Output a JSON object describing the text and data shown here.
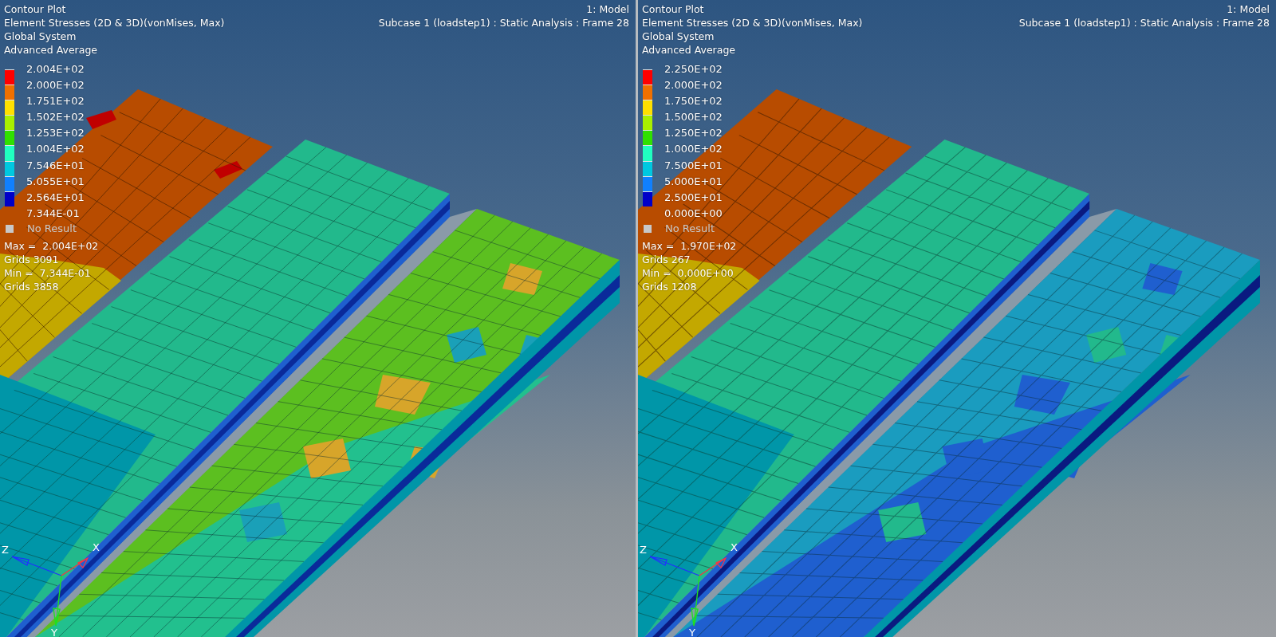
{
  "viewports": [
    {
      "header": {
        "title": "Contour Plot",
        "result": "Element Stresses (2D & 3D)(vonMises, Max)",
        "system": "Global System",
        "averaging": "Advanced Average",
        "model": "1: Model",
        "subcase": "Subcase 1 (loadstep1) : Static Analysis : Frame 28"
      },
      "legend": {
        "values": [
          "2.004E+02",
          "2.000E+02",
          "1.751E+02",
          "1.502E+02",
          "1.253E+02",
          "1.004E+02",
          "7.546E+01",
          "5.055E+01",
          "2.564E+01",
          "7.344E-01"
        ],
        "bands": [
          {
            "color": "#ff0000"
          },
          {
            "color": "#f07000"
          },
          {
            "color": "#ffe000"
          },
          {
            "color": "#a8f000"
          },
          {
            "color": "#30e000"
          },
          {
            "color": "#20ffc0"
          },
          {
            "color": "#00c8e0"
          },
          {
            "color": "#1080ff"
          },
          {
            "color": "#0000c8"
          }
        ],
        "no_result": "No Result"
      },
      "stats": [
        "Max =  2.004E+02",
        "Grids 3091",
        "Min =  7.344E-01",
        "Grids 3858"
      ],
      "axes": {
        "x": "X",
        "y": "Y",
        "z": "Z"
      }
    },
    {
      "header": {
        "title": "Contour Plot",
        "result": "Element Stresses (2D & 3D)(vonMises, Max)",
        "system": "Global System",
        "averaging": "Advanced Average",
        "model": "1: Model",
        "subcase": "Subcase 1 (loadstep1) : Static Analysis : Frame 28"
      },
      "legend": {
        "values": [
          "2.250E+02",
          "2.000E+02",
          "1.750E+02",
          "1.500E+02",
          "1.250E+02",
          "1.000E+02",
          "7.500E+01",
          "5.000E+01",
          "2.500E+01",
          "0.000E+00"
        ],
        "bands": [
          {
            "color": "#ff0000"
          },
          {
            "color": "#f07000"
          },
          {
            "color": "#ffe000"
          },
          {
            "color": "#a8f000"
          },
          {
            "color": "#30e000"
          },
          {
            "color": "#20ffc0"
          },
          {
            "color": "#00c8e0"
          },
          {
            "color": "#1080ff"
          },
          {
            "color": "#0000c8"
          }
        ],
        "no_result": "No Result"
      },
      "stats": [
        "Max =  1.970E+02",
        "Grids 267",
        "Min =  0.000E+00",
        "Grids 1208"
      ],
      "axes": {
        "x": "X",
        "y": "Y",
        "z": "Z"
      }
    }
  ]
}
